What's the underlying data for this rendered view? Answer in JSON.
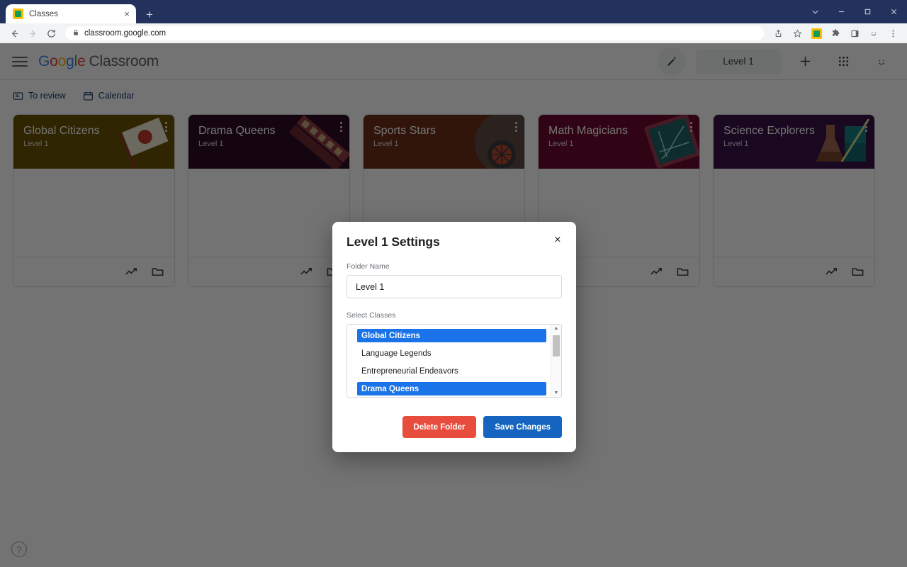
{
  "browser": {
    "tab": {
      "title": "Classes",
      "favicon": "classroom-favicon",
      "close": "×"
    },
    "new_tab": "+",
    "window_controls": {
      "chevron": "chevron-down",
      "minimize": "minimize",
      "maximize": "maximize",
      "close": "close"
    },
    "nav": {
      "back": "back-arrow",
      "forward": "forward-arrow",
      "reload": "reload-icon"
    },
    "omnibox": {
      "lock": "lock-icon",
      "url": "classroom.google.com"
    },
    "toolbar_icons": [
      "share-icon",
      "bookmark-star-icon",
      "classroom-extension-icon",
      "extensions-puzzle-icon",
      "side-panel-icon",
      "profile-icon",
      "chrome-menu-icon"
    ]
  },
  "header": {
    "menu_icon": "hamburger-icon",
    "brand": {
      "g1": "G",
      "o1": "o",
      "o2": "o",
      "g2": "g",
      "l1": "l",
      "e1": "e",
      "product": "Classroom"
    },
    "edit_icon": "pencil-icon",
    "level_pill": "Level 1",
    "add_icon": "plus-icon",
    "apps_icon": "apps-grid-icon",
    "avatar": "account-avatar"
  },
  "subnav": {
    "items": [
      {
        "label": "To review",
        "icon": "to-review-icon"
      },
      {
        "label": "Calendar",
        "icon": "calendar-icon"
      }
    ]
  },
  "cards": [
    {
      "title": "Global Citizens",
      "subtitle": "Level 1",
      "color": "#6b5303",
      "art": "flag-art"
    },
    {
      "title": "Drama Queens",
      "subtitle": "Level 1",
      "color": "#2d0c26",
      "art": "theater-art"
    },
    {
      "title": "Sports Stars",
      "subtitle": "Level 1",
      "color": "#6d2d18",
      "art": "sports-ball-art"
    },
    {
      "title": "Math Magicians",
      "subtitle": "Level 1",
      "color": "#6b0b2e",
      "art": "graph-tablet-art"
    },
    {
      "title": "Science Explorers",
      "subtitle": "Level 1",
      "color": "#3a1048",
      "art": "lab-beakers-art"
    }
  ],
  "card_footer": {
    "progress_icon": "trending-up-icon",
    "folder_icon": "folder-icon"
  },
  "help": {
    "label": "?"
  },
  "modal": {
    "title": "Level 1 Settings",
    "close": "×",
    "folder_name_label": "Folder Name",
    "folder_name_value": "Level 1",
    "folder_name_placeholder": "Folder Name",
    "select_classes_label": "Select Classes",
    "classes": [
      {
        "label": "Global Citizens",
        "selected": true
      },
      {
        "label": "Language Legends",
        "selected": false
      },
      {
        "label": "Entrepreneurial Endeavors",
        "selected": false
      },
      {
        "label": "Drama Queens",
        "selected": true
      }
    ],
    "scrollbar": {
      "up": "▲",
      "down": "▼"
    },
    "delete_label": "Delete Folder",
    "save_label": "Save Changes"
  },
  "colors": {
    "accent_blue": "#1a73e8",
    "primary_button": "#1565c0",
    "danger_button": "#e74c3c",
    "titlebar": "#22325c"
  }
}
